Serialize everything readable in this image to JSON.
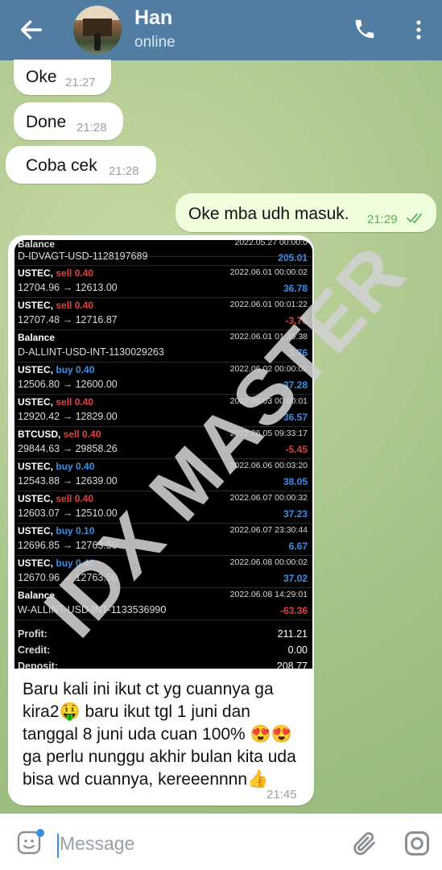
{
  "header": {
    "contact_name": "Han",
    "status": "online"
  },
  "messages": [
    {
      "direction": "in",
      "text": "Oke",
      "time": "21:27"
    },
    {
      "direction": "in",
      "text": "Done",
      "time": "21:28"
    },
    {
      "direction": "in",
      "text": "Coba cek",
      "time": "21:28"
    },
    {
      "direction": "out",
      "text": "Oke mba udh masuk.",
      "time": "21:29"
    }
  ],
  "screenshot": {
    "partial_top_label": "Balance",
    "partial_top_date": "2022.05.27 00:00:0",
    "first_line": "D-IDVAGT-USD-1128197689",
    "first_value": "205.01",
    "rows": [
      {
        "symbol": "USTEC,",
        "side": "sell",
        "lot": "0.40",
        "date": "2022.06.01 00:00:02",
        "prices": "12704.96 → 12613.00",
        "value": "36.78",
        "sign": "pos"
      },
      {
        "symbol": "USTEC,",
        "side": "sell",
        "lot": "0.40",
        "date": "2022.06.01 00:01:22",
        "prices": "12707.48 → 12716.87",
        "value": "-3.76",
        "sign": "neg"
      },
      {
        "symbol": "Balance",
        "side": "",
        "lot": "",
        "date": "2022.06.01 01:49:38",
        "prices": "D-ALLINT-USD-INT-1130029263",
        "value": "3.76",
        "sign": "pos"
      },
      {
        "symbol": "USTEC,",
        "side": "buy",
        "lot": "0.40",
        "date": "2022.06.02 00:00:02",
        "prices": "12506.80 → 12600.00",
        "value": "37.28",
        "sign": "pos"
      },
      {
        "symbol": "USTEC,",
        "side": "sell",
        "lot": "0.40",
        "date": "2022.06.03 00:00:01",
        "prices": "12920.42 → 12829.00",
        "value": "36.57",
        "sign": "pos"
      },
      {
        "symbol": "BTCUSD,",
        "side": "sell",
        "lot": "0.40",
        "date": "2022.06.05 09:33:17",
        "prices": "29844.63 → 29858.26",
        "value": "-5.45",
        "sign": "neg"
      },
      {
        "symbol": "USTEC,",
        "side": "buy",
        "lot": "0.40",
        "date": "2022.06.06 00:03:20",
        "prices": "12543.88 → 12639.00",
        "value": "38.05",
        "sign": "pos"
      },
      {
        "symbol": "USTEC,",
        "side": "sell",
        "lot": "0.40",
        "date": "2022.06.07 00:00:32",
        "prices": "12603.07 → 12510.00",
        "value": "37.23",
        "sign": "pos"
      },
      {
        "symbol": "USTEC,",
        "side": "buy",
        "lot": "0.10",
        "date": "2022.06.07 23:30:44",
        "prices": "12696.85 → 12763.50",
        "value": "6.67",
        "sign": "pos"
      },
      {
        "symbol": "USTEC,",
        "side": "buy",
        "lot": "0.40",
        "date": "2022.06.08 00:00:02",
        "prices": "12670.96 → 12763.50",
        "value": "37.02",
        "sign": "pos"
      },
      {
        "symbol": "Balance",
        "side": "",
        "lot": "",
        "date": "2022.06.08 14:29:01",
        "prices": "W-ALLINT-USD-INT-1133536990",
        "value": "-63.36",
        "sign": "neg"
      }
    ],
    "summary": [
      {
        "label": "Profit:",
        "value": "211.21"
      },
      {
        "label": "Credit:",
        "value": "0.00"
      },
      {
        "label": "Deposit:",
        "value": "208.77"
      }
    ],
    "watermark": "IDX MASTER"
  },
  "caption": {
    "text": "Baru kali ini ikut ct yg cuannya ga kira2🤑 baru ikut tgl 1 juni dan tanggal 8 juni uda cuan 100% 😍😍 ga perlu nunggu akhir bulan kita uda bisa wd cuannya, kereeennnn👍",
    "time": "21:45"
  },
  "input": {
    "placeholder": "Message"
  },
  "icons": {
    "back": "arrow-left-icon",
    "call": "phone-icon",
    "menu": "more-vertical-icon",
    "sticker": "sticker-icon",
    "attach": "paperclip-icon",
    "camera": "camera-icon"
  },
  "colors": {
    "header": "#517da2",
    "outgoing_bubble": "#efffde",
    "sell": "#e0433e",
    "buy": "#3b8fe6"
  }
}
